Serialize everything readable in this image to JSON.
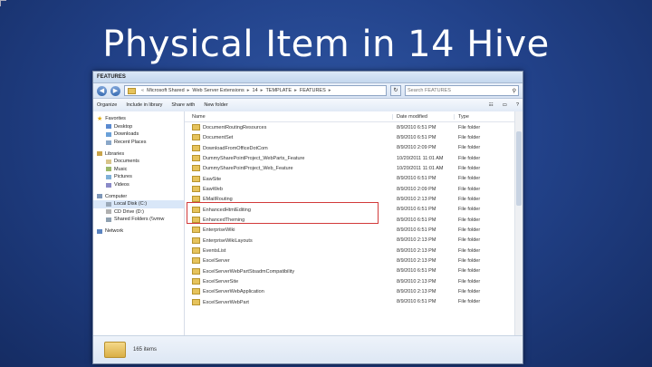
{
  "slide": {
    "title": "Physical Item in 14 Hive"
  },
  "window": {
    "title": "FEATURES",
    "address": [
      "Microsoft Shared",
      "Web Server Extensions",
      "14",
      "TEMPLATE",
      "FEATURES"
    ],
    "search_placeholder": "Search FEATURES",
    "toolbar": {
      "organize": "Organize",
      "include": "Include in library",
      "share": "Share with",
      "newfolder": "New folder"
    }
  },
  "nav": {
    "favorites": {
      "label": "Favorites",
      "items": [
        "Desktop",
        "Downloads",
        "Recent Places"
      ]
    },
    "libraries": {
      "label": "Libraries",
      "items": [
        "Documents",
        "Music",
        "Pictures",
        "Videos"
      ]
    },
    "computer": {
      "label": "Computer",
      "items": [
        "Local Disk (C:)",
        "CD Drive (D:)",
        "Shared Folders (\\\\vmw"
      ]
    },
    "network": {
      "label": "Network"
    }
  },
  "columns": {
    "name": "Name",
    "date": "Date modified",
    "type": "Type"
  },
  "files": [
    {
      "name": "DocumentRoutingResources",
      "date": "8/9/2010 6:51 PM",
      "type": "File folder"
    },
    {
      "name": "DocumentSet",
      "date": "8/9/2010 6:51 PM",
      "type": "File folder"
    },
    {
      "name": "DownloadFromOfficeDotCom",
      "date": "8/9/2010 2:09 PM",
      "type": "File folder"
    },
    {
      "name": "DummySharePointProject_WebParts_Feature",
      "date": "10/20/2011 11:01 AM",
      "type": "File folder"
    },
    {
      "name": "DummySharePointProject_Web_Feature",
      "date": "10/20/2011 11:01 AM",
      "type": "File folder"
    },
    {
      "name": "EawSite",
      "date": "8/9/2010 6:51 PM",
      "type": "File folder"
    },
    {
      "name": "EawWeb",
      "date": "8/9/2010 2:09 PM",
      "type": "File folder"
    },
    {
      "name": "EMailRouting",
      "date": "8/9/2010 2:13 PM",
      "type": "File folder"
    },
    {
      "name": "EnhancedHtmlEditing",
      "date": "8/9/2010 6:51 PM",
      "type": "File folder"
    },
    {
      "name": "EnhancedTheming",
      "date": "8/9/2010 6:51 PM",
      "type": "File folder"
    },
    {
      "name": "EnterpriseWiki",
      "date": "8/9/2010 6:51 PM",
      "type": "File folder"
    },
    {
      "name": "EnterpriseWikiLayouts",
      "date": "8/9/2010 2:13 PM",
      "type": "File folder"
    },
    {
      "name": "EventsList",
      "date": "8/9/2010 2:13 PM",
      "type": "File folder"
    },
    {
      "name": "ExcelServer",
      "date": "8/9/2010 2:13 PM",
      "type": "File folder"
    },
    {
      "name": "ExcelServerWebPartStsadmCompatibility",
      "date": "8/9/2010 6:51 PM",
      "type": "File folder"
    },
    {
      "name": "ExcelServerSite",
      "date": "8/9/2010 2:13 PM",
      "type": "File folder"
    },
    {
      "name": "ExcelServerWebApplication",
      "date": "8/9/2010 2:13 PM",
      "type": "File folder"
    },
    {
      "name": "ExcelServerWebPart",
      "date": "8/9/2010 6:51 PM",
      "type": "File folder"
    }
  ],
  "status": {
    "count": "165 items"
  },
  "colors": {
    "folder": "#e6c35c",
    "highlight": "#d23a3a",
    "background": "#22428a"
  }
}
